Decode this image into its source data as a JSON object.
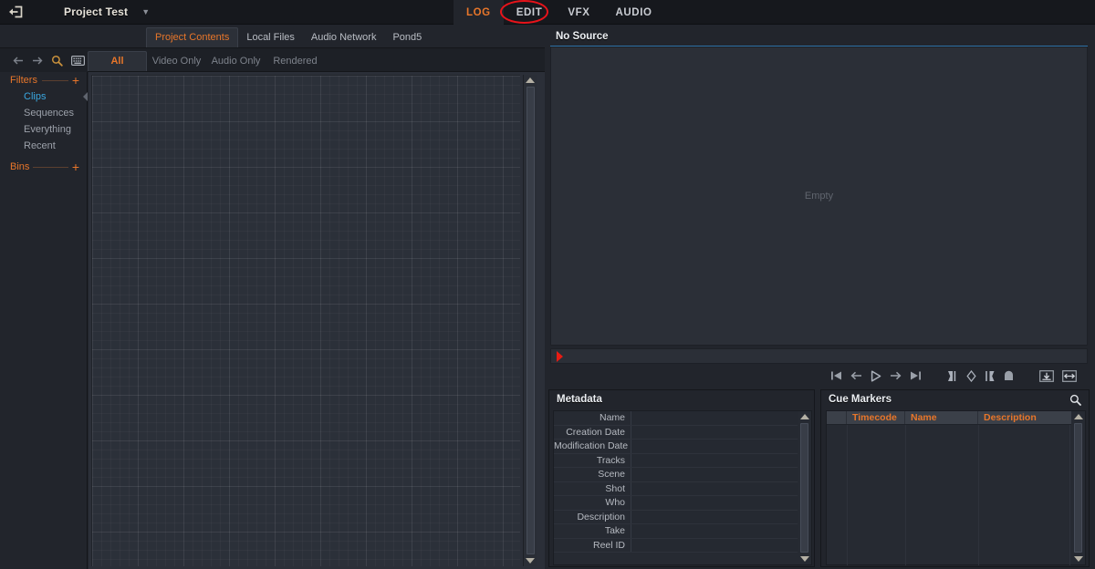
{
  "titlebar": {
    "exit_icon": "exit-icon",
    "project_name": "Project Test",
    "caret": "▼",
    "modes": [
      {
        "label": "LOG",
        "active": true
      },
      {
        "label": "EDIT",
        "active": false
      },
      {
        "label": "VFX",
        "active": false
      },
      {
        "label": "AUDIO",
        "active": false
      }
    ]
  },
  "annotation": {
    "shape": "red-ellipse",
    "target": "EDIT",
    "color": "#e8131a"
  },
  "browser": {
    "tabs": [
      {
        "label": "Project Contents",
        "active": true
      },
      {
        "label": "Local Files",
        "active": false
      },
      {
        "label": "Audio Network",
        "active": false
      },
      {
        "label": "Pond5",
        "active": false
      }
    ],
    "tools": [
      "back-arrow-icon",
      "forward-arrow-icon",
      "search-icon",
      "keyboard-icon"
    ],
    "filter_tabs": [
      {
        "label": "All",
        "active": true
      },
      {
        "label": "Video Only",
        "active": false
      },
      {
        "label": "Audio Only",
        "active": false
      },
      {
        "label": "Rendered",
        "active": false
      }
    ],
    "sidebar": {
      "filters_header": "Filters",
      "filters_add": "+",
      "filters": [
        {
          "label": "Clips",
          "selected": true
        },
        {
          "label": "Sequences",
          "selected": false
        },
        {
          "label": "Everything",
          "selected": false
        },
        {
          "label": "Recent",
          "selected": false
        }
      ],
      "bins_header": "Bins",
      "bins_add": "+"
    }
  },
  "monitor": {
    "title": "No Source",
    "viewer_placeholder": "Empty",
    "accent_underline": "#2f73a8",
    "playhead_color": "#e81b13",
    "transport": [
      "go-to-start-icon",
      "step-back-icon",
      "play-icon",
      "step-forward-icon",
      "go-to-end-icon",
      "mark-in-icon",
      "add-marker-icon",
      "mark-out-icon",
      "clear-marks-icon",
      "insert-icon",
      "overwrite-icon"
    ]
  },
  "metadata": {
    "title": "Metadata",
    "rows": [
      {
        "label": "Name",
        "value": ""
      },
      {
        "label": "Creation Date",
        "value": ""
      },
      {
        "label": "Modification Date",
        "value": ""
      },
      {
        "label": "Tracks",
        "value": ""
      },
      {
        "label": "Scene",
        "value": ""
      },
      {
        "label": "Shot",
        "value": ""
      },
      {
        "label": "Who",
        "value": ""
      },
      {
        "label": "Description",
        "value": ""
      },
      {
        "label": "Take",
        "value": ""
      },
      {
        "label": "Reel ID",
        "value": ""
      }
    ]
  },
  "cue_markers": {
    "title": "Cue Markers",
    "search_icon": "search-icon",
    "columns": [
      "",
      "Timecode",
      "Name",
      "Description"
    ],
    "rows": []
  },
  "colors": {
    "accent_orange": "#e8762a",
    "selected_blue": "#3aa7e0",
    "panel_bg": "#22252c",
    "grid_bg": "#2b3039"
  }
}
